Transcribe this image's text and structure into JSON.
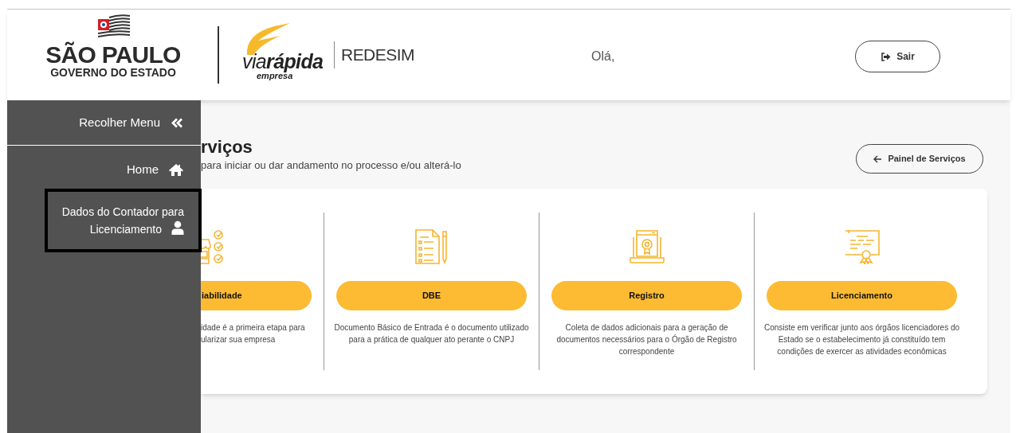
{
  "header": {
    "logo_primary": {
      "title": "SÃO PAULO",
      "subtitle": "GOVERNO DO ESTADO"
    },
    "logo_secondary": {
      "word_1": "via",
      "word_2": "rápida",
      "tagline": "empresa",
      "product": "REDESIM"
    },
    "greeting": "Olá,",
    "logout_button": "Sair"
  },
  "sidebar": {
    "collapse": "Recolher Menu",
    "items": [
      {
        "label": "Home",
        "selected": false
      },
      {
        "label": "Dados do Contador para Licenciamento",
        "selected": true
      }
    ]
  },
  "main": {
    "title": "rviços",
    "subtitle": "para iniciar ou dar andamento no processo e/ou alterá-lo",
    "back_button": "Painel de Serviços",
    "services": [
      {
        "kind": "clipped",
        "label": "iabilidade",
        "description": [
          "idade é a primeira etapa para",
          "ularizar sua empresa"
        ]
      },
      {
        "kind": "full",
        "label": "DBE",
        "description": [
          "Documento Básico de Entrada é o documento utilizado para a prática de qualquer ato perante o CNPJ"
        ]
      },
      {
        "kind": "full",
        "label": "Registro",
        "description": [
          "Coleta de dados adicionais para a geração de documentos necessários para o Órgão de Registro correspondente"
        ]
      },
      {
        "kind": "full",
        "label": "Licenciamento",
        "description": [
          "Consiste em verificar junto aos órgãos licenciadores do Estado se o estabelecimento já constituído tem condições de exercer as atividades econômicas"
        ]
      }
    ]
  }
}
